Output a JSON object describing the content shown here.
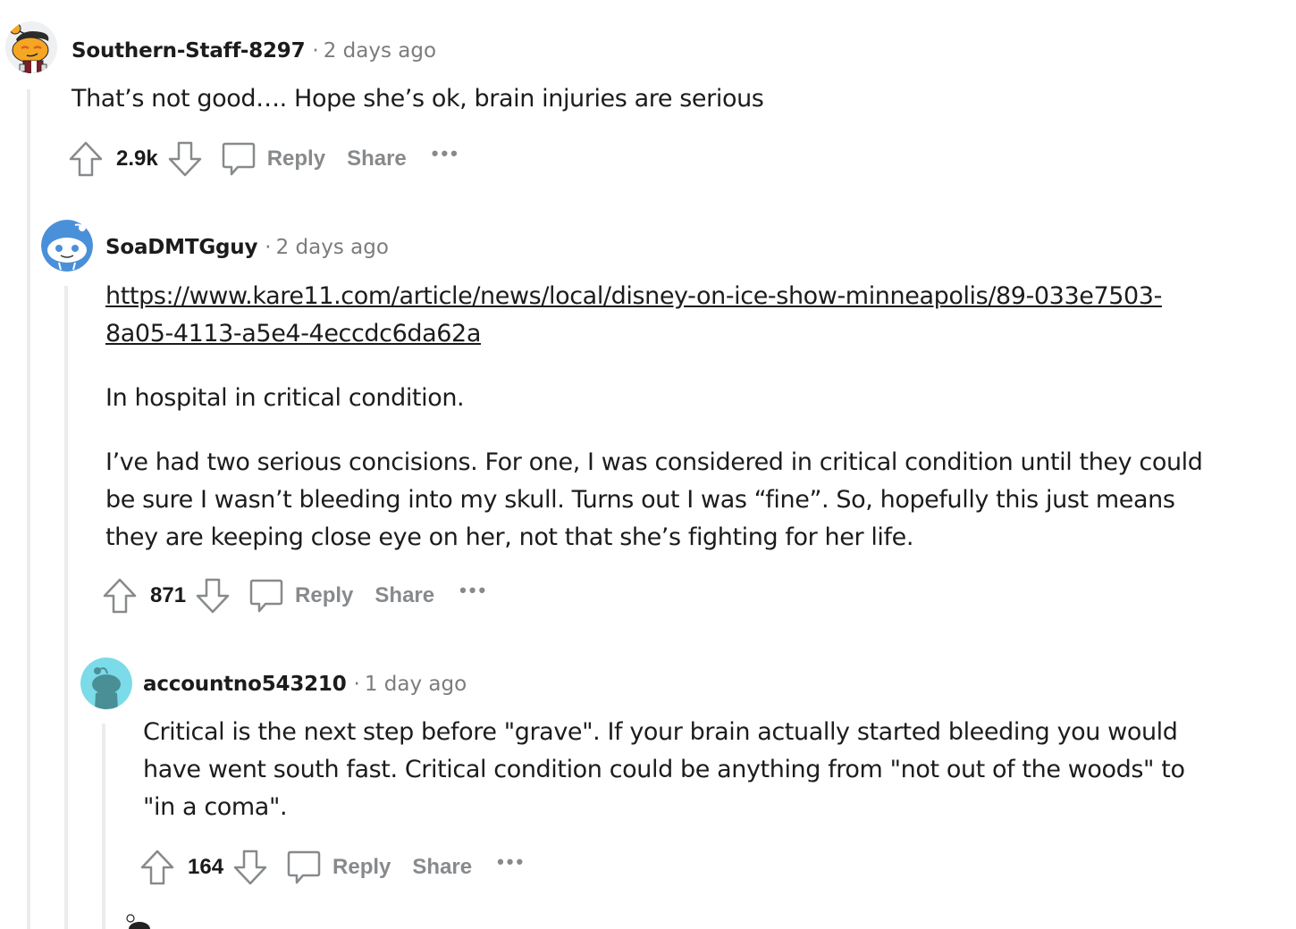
{
  "comments": [
    {
      "author": "Southern-Staff-8297",
      "separator": "·",
      "time": "2 days ago",
      "avatar": "snoo-orange-avatar",
      "paragraphs": [
        "That’s not good…. Hope she’s ok, brain injuries are serious"
      ],
      "score": "2.9k",
      "reply_label": "Reply",
      "share_label": "Share",
      "more_label": "•••"
    },
    {
      "author": "SoaDMTGguy",
      "separator": "·",
      "time": "2 days ago",
      "avatar": "snoo-blue-avatar",
      "link_line1": "https://www.kare11.com/article/news/local/disney-on-ice-show-minneapolis/89-033e7503-",
      "link_line2": "8a05-4113-a5e4-4eccdc6da62a",
      "paragraphs": [
        "In hospital in critical condition.",
        "I’ve had two serious concisions. For one, I was considered in critical condition until they could be sure I wasn’t bleeding into my skull. Turns out I was “fine”. So, hopefully this just means they are keeping close eye on her, not that she’s fighting for her life."
      ],
      "score": "871",
      "reply_label": "Reply",
      "share_label": "Share",
      "more_label": "•••"
    },
    {
      "author": "accountno543210",
      "separator": "·",
      "time": "1 day ago",
      "avatar": "snoo-teal-avatar",
      "paragraphs": [
        "Critical is the next step before \"grave\". If your brain actually started bleeding you would have went south fast. Critical condition could be anything from \"not out of the woods\" to \"in a coma\"."
      ],
      "score": "164",
      "reply_label": "Reply",
      "share_label": "Share",
      "more_label": "•••"
    }
  ]
}
